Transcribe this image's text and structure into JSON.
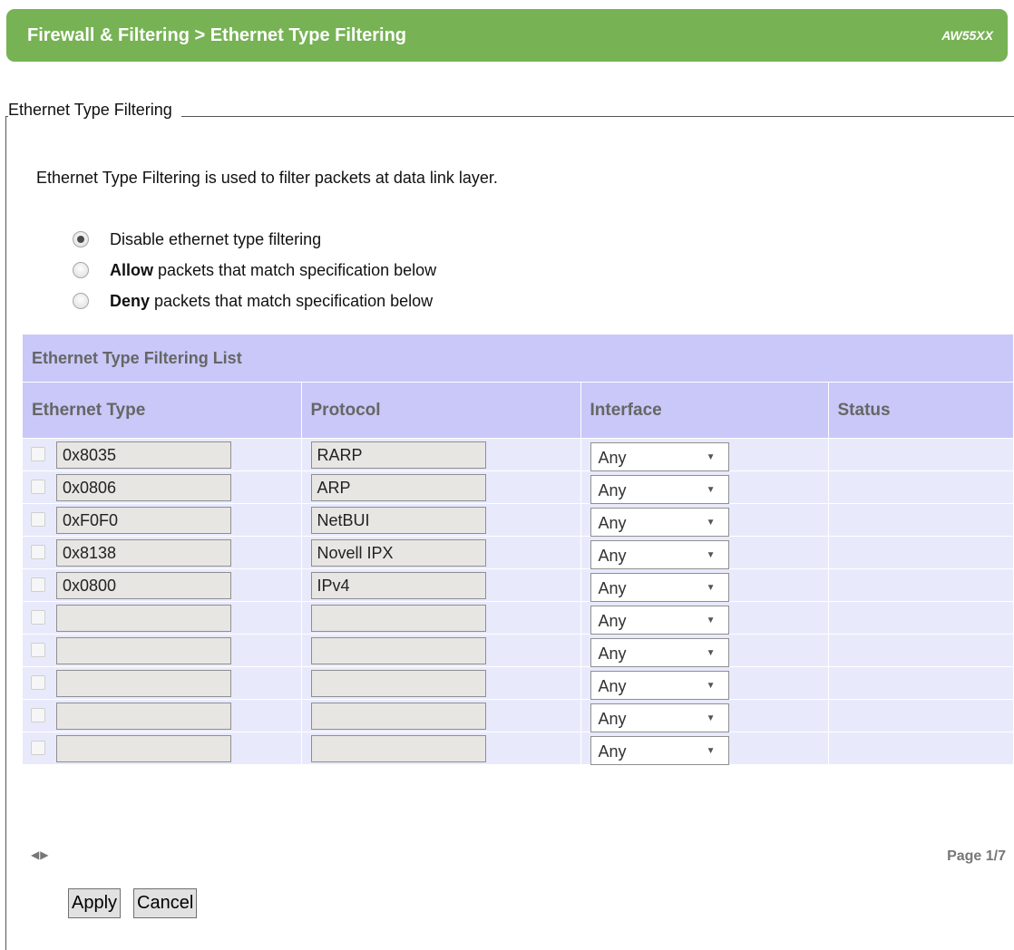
{
  "header": {
    "title": "Firewall & Filtering > Ethernet Type Filtering",
    "model": "AW55XX"
  },
  "section": {
    "legend": "Ethernet Type Filtering",
    "description": "Ethernet Type Filtering is used to filter packets at data link layer."
  },
  "radios": [
    {
      "bold": "",
      "label": "Disable ethernet type filtering",
      "checked": true
    },
    {
      "bold": "Allow",
      "label": " packets that match specification below",
      "checked": false
    },
    {
      "bold": "Deny",
      "label": " packets that match specification below",
      "checked": false
    }
  ],
  "table": {
    "title": "Ethernet Type Filtering List",
    "columns": [
      "Ethernet Type",
      "Protocol",
      "Interface",
      "Status"
    ],
    "rows": [
      {
        "type": "0x8035",
        "protocol": "RARP",
        "interface": "Any",
        "status": ""
      },
      {
        "type": "0x0806",
        "protocol": "ARP",
        "interface": "Any",
        "status": ""
      },
      {
        "type": "0xF0F0",
        "protocol": "NetBUI",
        "interface": "Any",
        "status": ""
      },
      {
        "type": "0x8138",
        "protocol": "Novell IPX",
        "interface": "Any",
        "status": ""
      },
      {
        "type": "0x0800",
        "protocol": "IPv4",
        "interface": "Any",
        "status": ""
      },
      {
        "type": "",
        "protocol": "",
        "interface": "Any",
        "status": ""
      },
      {
        "type": "",
        "protocol": "",
        "interface": "Any",
        "status": ""
      },
      {
        "type": "",
        "protocol": "",
        "interface": "Any",
        "status": ""
      },
      {
        "type": "",
        "protocol": "",
        "interface": "Any",
        "status": ""
      },
      {
        "type": "",
        "protocol": "",
        "interface": "Any",
        "status": ""
      }
    ]
  },
  "pagination": {
    "arrows": "◀▶",
    "page": "Page 1/7"
  },
  "buttons": {
    "apply": "Apply",
    "cancel": "Cancel"
  }
}
